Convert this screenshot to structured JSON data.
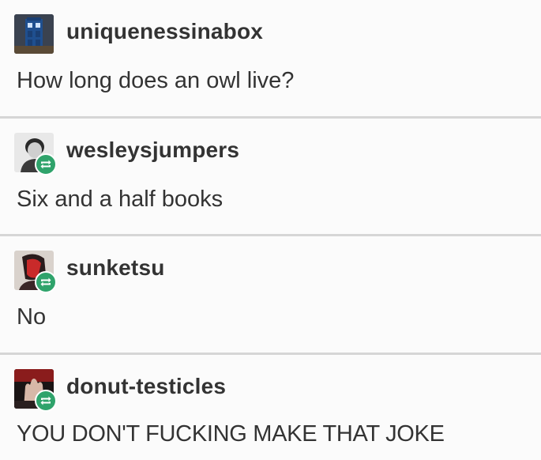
{
  "posts": [
    {
      "username": "uniquenessinabox",
      "text": "How long does an owl live?",
      "avatar_icon": "tardis-avatar",
      "reblog": false
    },
    {
      "username": "wesleysjumpers",
      "text": "Six and a half books",
      "avatar_icon": "person-avatar",
      "reblog": true,
      "reblog_icon": "reblog-icon"
    },
    {
      "username": "sunketsu",
      "text": "No",
      "avatar_icon": "red-figure-avatar",
      "reblog": true,
      "reblog_icon": "reblog-icon"
    },
    {
      "username": "donut-testicles",
      "text": "YOU DON'T FUCKING MAKE THAT JOKE",
      "avatar_icon": "hand-avatar",
      "reblog": true,
      "reblog_icon": "reblog-icon"
    }
  ],
  "colors": {
    "reblog_badge": "#2fa36b",
    "divider": "#d6d6d6",
    "text": "#333333"
  }
}
